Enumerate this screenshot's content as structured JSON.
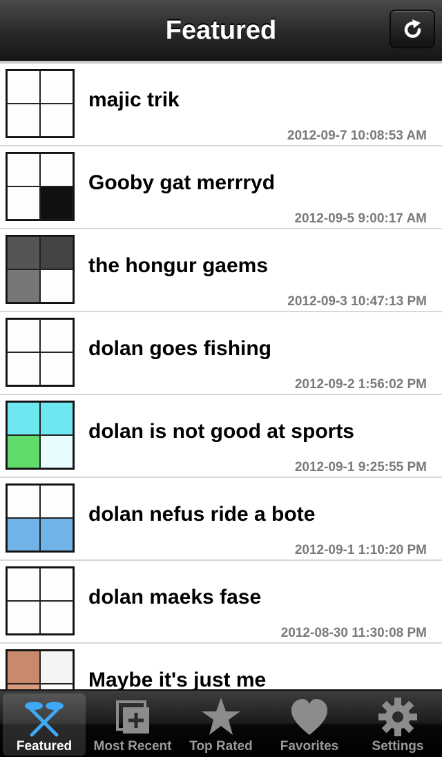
{
  "navbar": {
    "title": "Featured",
    "refresh_icon": "refresh-icon"
  },
  "items": [
    {
      "title": "majic trik",
      "date": "2012-09-7 10:08:53 AM"
    },
    {
      "title": "Gooby gat merrryd",
      "date": "2012-09-5 9:00:17 AM"
    },
    {
      "title": "the hongur gaems",
      "date": "2012-09-3 10:47:13 PM"
    },
    {
      "title": "dolan goes fishing",
      "date": "2012-09-2 1:56:02 PM"
    },
    {
      "title": "dolan is not good at sports",
      "date": "2012-09-1 9:25:55 PM"
    },
    {
      "title": "dolan nefus ride a bote",
      "date": "2012-09-1 1:10:20 PM"
    },
    {
      "title": "dolan maeks fase",
      "date": "2012-08-30 11:30:08 PM"
    },
    {
      "title": "Maybe it's just me",
      "date": ""
    }
  ],
  "tabs": [
    {
      "label": "Featured",
      "icon": "featured-icon",
      "active": true
    },
    {
      "label": "Most Recent",
      "icon": "most-recent-icon",
      "active": false
    },
    {
      "label": "Top Rated",
      "icon": "star-icon",
      "active": false
    },
    {
      "label": "Favorites",
      "icon": "heart-icon",
      "active": false
    },
    {
      "label": "Settings",
      "icon": "gear-icon",
      "active": false
    }
  ],
  "colors": {
    "active_tab_icon": "#3fa9f5",
    "inactive_tab_icon": "#8c8c8c",
    "date_text": "#7a7a7a"
  }
}
